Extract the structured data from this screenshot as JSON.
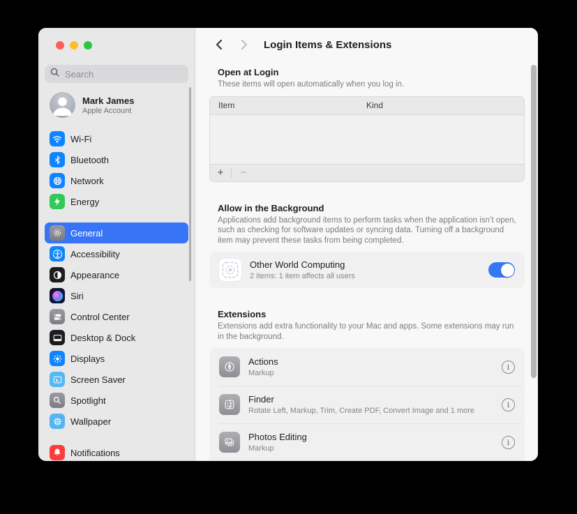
{
  "colors": {
    "selection_blue": "#3875f6",
    "toggle_on": "#3478f6",
    "traffic_red": "#ff5f57",
    "traffic_yellow": "#febc2e",
    "traffic_green": "#28c840"
  },
  "sidebar": {
    "search": {
      "placeholder": "Search"
    },
    "account": {
      "name": "Mark James",
      "subtitle": "Apple Account"
    },
    "groups": [
      {
        "items": [
          {
            "label": "Wi-Fi",
            "icon": "wifi-icon"
          },
          {
            "label": "Bluetooth",
            "icon": "bluetooth-icon"
          },
          {
            "label": "Network",
            "icon": "globe-icon"
          },
          {
            "label": "Energy",
            "icon": "bolt-icon"
          }
        ]
      },
      {
        "items": [
          {
            "label": "General",
            "icon": "gear-icon",
            "selected": true
          },
          {
            "label": "Accessibility",
            "icon": "accessibility-icon"
          },
          {
            "label": "Appearance",
            "icon": "appearance-icon"
          },
          {
            "label": "Siri",
            "icon": "siri-icon"
          },
          {
            "label": "Control Center",
            "icon": "control-center-icon"
          },
          {
            "label": "Desktop & Dock",
            "icon": "desktop-dock-icon"
          },
          {
            "label": "Displays",
            "icon": "sun-icon"
          },
          {
            "label": "Screen Saver",
            "icon": "screen-saver-icon"
          },
          {
            "label": "Spotlight",
            "icon": "magnifier-icon"
          },
          {
            "label": "Wallpaper",
            "icon": "flower-icon"
          }
        ]
      },
      {
        "items": [
          {
            "label": "Notifications",
            "icon": "bell-icon"
          }
        ]
      }
    ]
  },
  "content": {
    "title": "Login Items & Extensions",
    "open_at_login": {
      "heading": "Open at Login",
      "description": "These items will open automatically when you log in.",
      "table": {
        "columns": [
          "Item",
          "Kind"
        ],
        "rows": []
      },
      "add_label": "+",
      "remove_label": "−"
    },
    "allow_background": {
      "heading": "Allow in the Background",
      "description": "Applications add background items to perform tasks when the application isn’t open, such as checking for software updates or syncing data. Turning off a background item may prevent these tasks from being completed.",
      "items": [
        {
          "name": "Other World Computing",
          "detail": "2 items: 1 item affects all users",
          "toggle_on": true
        }
      ]
    },
    "extensions": {
      "heading": "Extensions",
      "description": "Extensions add extra functionality to your Mac and apps. Some extensions may run in the background.",
      "items": [
        {
          "name": "Actions",
          "detail": "Markup"
        },
        {
          "name": "Finder",
          "detail": "Rotate Left, Markup, Trim, Create PDF, Convert Image and 1 more"
        },
        {
          "name": "Photos Editing",
          "detail": "Markup"
        }
      ]
    }
  }
}
